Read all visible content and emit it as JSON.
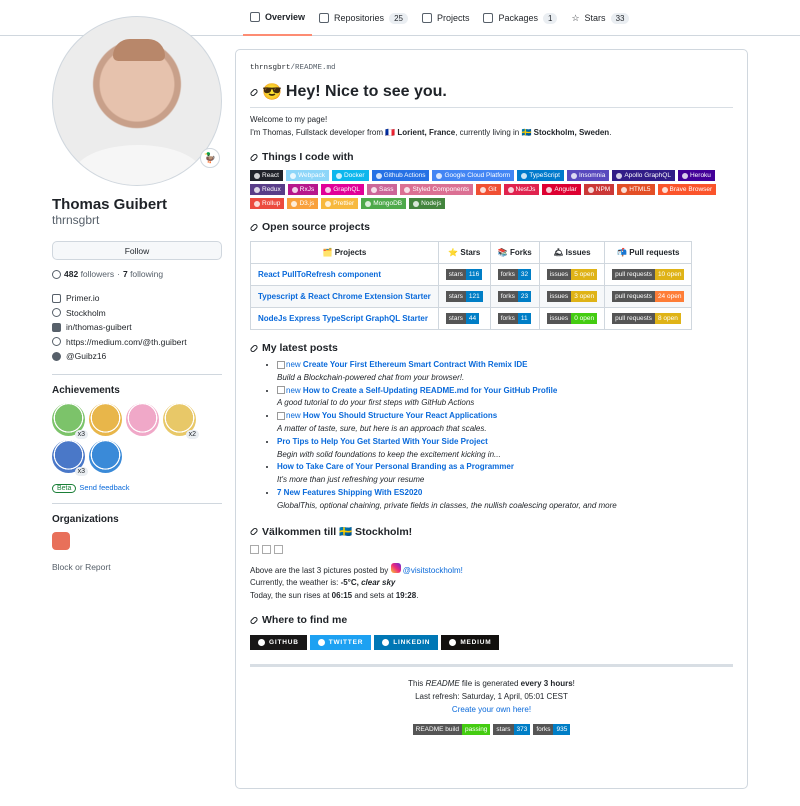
{
  "tabs": [
    {
      "label": "Overview",
      "count": ""
    },
    {
      "label": "Repositories",
      "count": "25"
    },
    {
      "label": "Projects",
      "count": ""
    },
    {
      "label": "Packages",
      "count": "1"
    },
    {
      "label": "Stars",
      "count": "33"
    }
  ],
  "profile": {
    "status_emoji": "🦆",
    "name": "Thomas Guibert",
    "login": "thrnsgbrt",
    "follow_label": "Follow",
    "followers_count": "482",
    "followers_label": "followers",
    "following_count": "7",
    "following_label": "following",
    "company": "Primer.io",
    "location": "Stockholm",
    "linkedin": "in/thomas-guibert",
    "website": "https://medium.com/@th.guibert",
    "twitter": "@Guibz16"
  },
  "achievements": {
    "title": "Achievements",
    "badges": [
      {
        "color": "#7cc36a",
        "count": "x3"
      },
      {
        "color": "#e8b64a",
        "count": ""
      },
      {
        "color": "#f0a8c8",
        "count": ""
      },
      {
        "color": "#e8c868",
        "count": "x2"
      },
      {
        "color": "#4a78c8",
        "count": "x3"
      },
      {
        "color": "#3a8ad8",
        "count": ""
      }
    ],
    "beta_label": "Beta",
    "feedback_label": "Send feedback"
  },
  "organizations": {
    "title": "Organizations",
    "block_label": "Block or Report"
  },
  "readme": {
    "crumb_user": "thrnsgbrt",
    "crumb_sep": "/",
    "crumb_file": "README.md",
    "title_emoji": "😎",
    "title": "Hey! Nice to see you.",
    "welcome": "Welcome to my page!",
    "intro_pre": "I'm Thomas, Fullstack developer from ",
    "intro_from": "🇫🇷 Lorient, France",
    "intro_mid": ", currently living in ",
    "intro_to": "🇸🇪 Stockholm, Sweden",
    "intro_end": ".",
    "things_title": "Things I code with",
    "shields": [
      {
        "t": "React",
        "c": "#20232a"
      },
      {
        "t": "Webpack",
        "c": "#8dd6f9"
      },
      {
        "t": "Docker",
        "c": "#0db7ed"
      },
      {
        "t": "Github Actions",
        "c": "#2671e5"
      },
      {
        "t": "Google Cloud Platform",
        "c": "#4285f4"
      },
      {
        "t": "TypeScript",
        "c": "#007acc"
      },
      {
        "t": "Insomnia",
        "c": "#5849be"
      },
      {
        "t": "Apollo GraphQL",
        "c": "#311c87"
      },
      {
        "t": "Heroku",
        "c": "#430098"
      },
      {
        "t": "Redux",
        "c": "#593d88"
      },
      {
        "t": "RxJs",
        "c": "#b7178c"
      },
      {
        "t": "GraphQL",
        "c": "#e10098"
      },
      {
        "t": "Sass",
        "c": "#cc6699"
      },
      {
        "t": "Styled Components",
        "c": "#db7093"
      },
      {
        "t": "Git",
        "c": "#f05033"
      },
      {
        "t": "NestJs",
        "c": "#e0234e"
      },
      {
        "t": "Angular",
        "c": "#dd0031"
      },
      {
        "t": "NPM",
        "c": "#cb3837"
      },
      {
        "t": "HTML5",
        "c": "#e34f26"
      },
      {
        "t": "Brave Browser",
        "c": "#fb542b"
      },
      {
        "t": "Rollup",
        "c": "#ec4a3f"
      },
      {
        "t": "D3.js",
        "c": "#f9a03c"
      },
      {
        "t": "Prettier",
        "c": "#f7b93e"
      },
      {
        "t": "MongoDB",
        "c": "#4ea94b"
      },
      {
        "t": "Nodejs",
        "c": "#43853d"
      }
    ],
    "os_title": "Open source projects",
    "table_headers": [
      {
        "e": "🗂️",
        "t": "Projects"
      },
      {
        "e": "⭐",
        "t": "Stars"
      },
      {
        "e": "📚",
        "t": "Forks"
      },
      {
        "e": "🛎",
        "t": "Issues"
      },
      {
        "e": "📬",
        "t": "Pull requests"
      }
    ],
    "projects": [
      {
        "name": "React PullToRefresh component",
        "stars_label": "stars",
        "stars": "116",
        "forks_label": "forks",
        "forks": "32",
        "issues_label": "issues",
        "issues": "5 open",
        "issues_color": "#dfb317",
        "pr_label": "pull requests",
        "pr": "10 open",
        "pr_color": "#dfb317"
      },
      {
        "name": "Typescript & React Chrome Extension Starter",
        "stars_label": "stars",
        "stars": "121",
        "forks_label": "forks",
        "forks": "23",
        "issues_label": "issues",
        "issues": "3 open",
        "issues_color": "#dfb317",
        "pr_label": "pull requests",
        "pr": "24 open",
        "pr_color": "#fe7d37"
      },
      {
        "name": "NodeJs Express TypeScript GraphQL Starter",
        "stars_label": "stars",
        "stars": "44",
        "forks_label": "forks",
        "forks": "11",
        "issues_label": "issues",
        "issues": "0 open",
        "issues_color": "#4c1",
        "pr_label": "pull requests",
        "pr": "8 open",
        "pr_color": "#dfb317"
      }
    ],
    "posts_title": "My latest posts",
    "posts": [
      {
        "img": "new",
        "title": "Create Your First Ethereum Smart Contract With Remix IDE",
        "desc": "Build a Blockchain-powered chat from your browser!."
      },
      {
        "img": "new",
        "title": "How to Create a Self-Updating README.md for Your GitHub Profile",
        "desc": "A good tutorial to do your first steps with GitHub Actions"
      },
      {
        "img": "new",
        "title": "How You Should Structure Your React Applications",
        "desc": "A matter of taste, sure, but here is an approach that scales."
      },
      {
        "img": "",
        "title": "Pro Tips to Help You Get Started With Your Side Project",
        "desc": "Begin with solid foundations to keep the excitement kicking in..."
      },
      {
        "img": "",
        "title": "How to Take Care of Your Personal Branding as a Programmer",
        "desc": "It's more than just refreshing your resume"
      },
      {
        "img": "",
        "title": "7 New Features Shipping With ES2020",
        "desc": "GlobalThis, optional chaining, private fields in classes, the nullish coalescing operator, and more"
      }
    ],
    "sthlm_title": "Välkommen till 🇸🇪 Stockholm!",
    "pics_text": "Above are the last 3 pictures posted by ",
    "pics_handle": "@visitstockholm!",
    "weather_pre": "Currently, the weather is: ",
    "weather_temp": "-5°C, ",
    "weather_cond": "clear sky",
    "sun_pre": "Today, the sun rises at ",
    "sun_rise": "06:15",
    "sun_mid": " and sets at ",
    "sun_set": "19:28",
    "sun_end": ".",
    "find_title": "Where to find me",
    "socials": [
      {
        "t": "GITHUB",
        "c": "#181717"
      },
      {
        "t": "TWITTER",
        "c": "#1da1f2"
      },
      {
        "t": "LINKEDIN",
        "c": "#0077b5"
      },
      {
        "t": "MEDIUM",
        "c": "#12100e"
      }
    ],
    "foot_pre": "This ",
    "foot_file": "README",
    "foot_mid": " file is generated ",
    "foot_freq": "every 3 hours",
    "foot_end": "!",
    "refresh": "Last refresh: Saturday, 1 April, 05:01 CEST",
    "create": "Create your own here!",
    "fbadges": [
      {
        "l": "README build",
        "v": "passing",
        "c": "#4c1"
      },
      {
        "l": "stars",
        "v": "373",
        "c": "#007ec6"
      },
      {
        "l": "forks",
        "v": "935",
        "c": "#007ec6"
      }
    ]
  }
}
